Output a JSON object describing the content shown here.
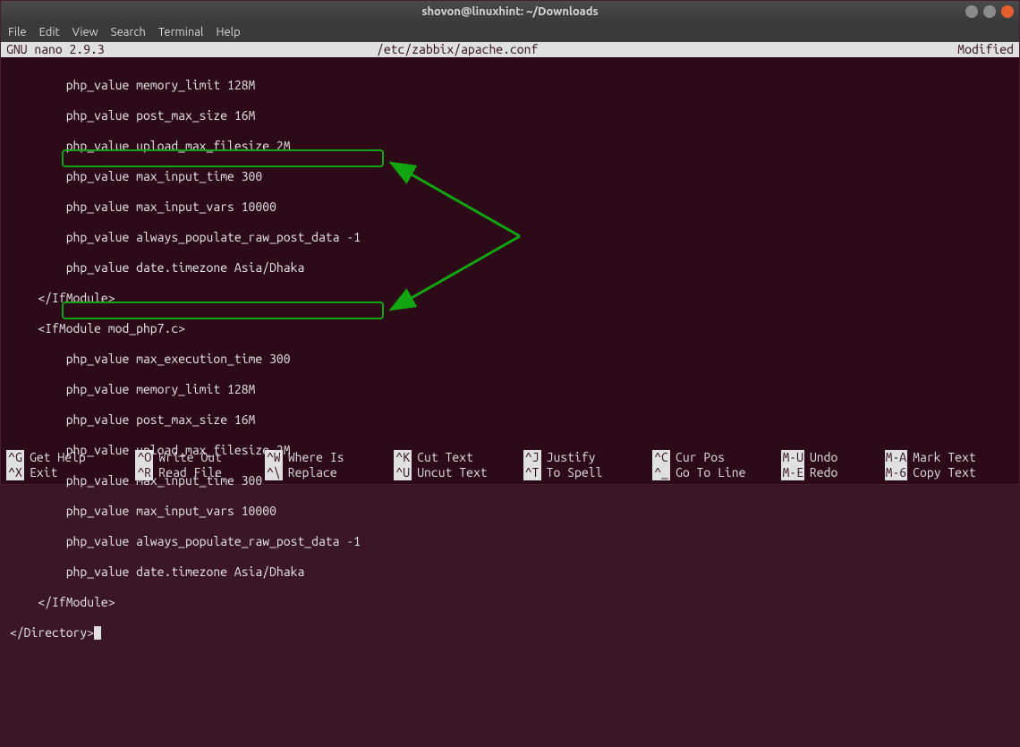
{
  "titlebar": {
    "title": "shovon@linuxhint: ~/Downloads"
  },
  "menubar": {
    "file": "File",
    "edit": "Edit",
    "view": "View",
    "search": "Search",
    "terminal": "Terminal",
    "help": "Help"
  },
  "nano": {
    "version": "GNU nano 2.9.3",
    "filepath": "/etc/zabbix/apache.conf",
    "status": "Modified"
  },
  "lines": {
    "l01": "        php_value memory_limit 128M",
    "l02": "        php_value post_max_size 16M",
    "l03": "        php_value upload_max_filesize 2M",
    "l04": "        php_value max_input_time 300",
    "l05": "        php_value max_input_vars 10000",
    "l06": "        php_value always_populate_raw_post_data -1",
    "l07": "        php_value date.timezone Asia/Dhaka",
    "l08": "    </IfModule>",
    "l09": "    <IfModule mod_php7.c>",
    "l10": "        php_value max_execution_time 300",
    "l11": "        php_value memory_limit 128M",
    "l12": "        php_value post_max_size 16M",
    "l13": "        php_value upload_max_filesize 2M",
    "l14": "        php_value max_input_time 300",
    "l15": "        php_value max_input_vars 10000",
    "l16": "        php_value always_populate_raw_post_data -1",
    "l17": "        php_value date.timezone Asia/Dhaka",
    "l18": "    </IfModule>",
    "l19": "</Directory>"
  },
  "shortcuts": {
    "row1": [
      {
        "key": "^G",
        "label": "Get Help"
      },
      {
        "key": "^O",
        "label": "Write Out"
      },
      {
        "key": "^W",
        "label": "Where Is"
      },
      {
        "key": "^K",
        "label": "Cut Text"
      },
      {
        "key": "^J",
        "label": "Justify"
      },
      {
        "key": "^C",
        "label": "Cur Pos"
      },
      {
        "key": "M-U",
        "label": "Undo"
      },
      {
        "key": "M-A",
        "label": "Mark Text"
      }
    ],
    "row2": [
      {
        "key": "^X",
        "label": "Exit"
      },
      {
        "key": "^R",
        "label": "Read File"
      },
      {
        "key": "^\\",
        "label": "Replace"
      },
      {
        "key": "^U",
        "label": "Uncut Text"
      },
      {
        "key": "^T",
        "label": "To Spell"
      },
      {
        "key": "^_",
        "label": "Go To Line"
      },
      {
        "key": "M-E",
        "label": "Redo"
      },
      {
        "key": "M-6",
        "label": "Copy Text"
      }
    ]
  }
}
